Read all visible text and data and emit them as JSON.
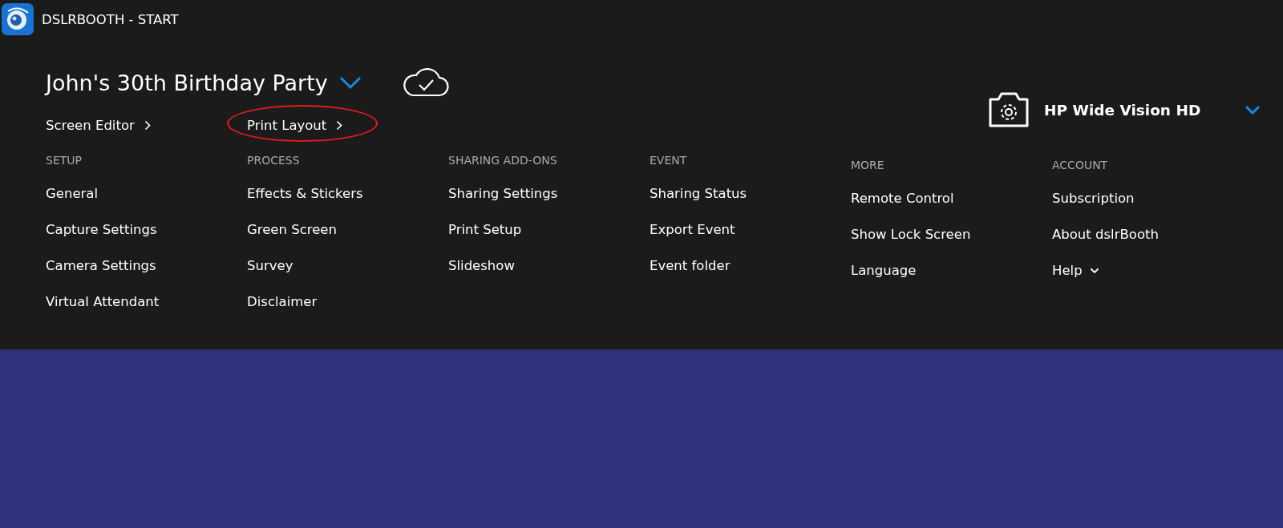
{
  "window": {
    "title": "DSLRBOOTH - START"
  },
  "event": {
    "name": "John's 30th Birthday Party",
    "synced": true
  },
  "camera": {
    "name": "HP Wide Vision HD"
  },
  "links": [
    {
      "label": "Screen Editor",
      "highlighted": false
    },
    {
      "label": "Print Layout",
      "highlighted": true
    }
  ],
  "sections": [
    {
      "title": "SETUP",
      "items": [
        {
          "label": "General",
          "kind": "link"
        },
        {
          "label": "Capture Settings",
          "kind": "link"
        },
        {
          "label": "Camera Settings",
          "kind": "link"
        },
        {
          "label": "Virtual Attendant",
          "kind": "link"
        }
      ]
    },
    {
      "title": "PROCESS",
      "items": [
        {
          "label": "Effects & Stickers",
          "kind": "link"
        },
        {
          "label": "Green Screen",
          "kind": "link"
        },
        {
          "label": "Survey",
          "kind": "link"
        },
        {
          "label": "Disclaimer",
          "kind": "link"
        }
      ]
    },
    {
      "title": "SHARING ADD-ONS",
      "items": [
        {
          "label": "Sharing Settings",
          "kind": "link"
        },
        {
          "label": "Print Setup",
          "kind": "link"
        },
        {
          "label": "Slideshow",
          "kind": "link"
        }
      ]
    },
    {
      "title": "EVENT",
      "items": [
        {
          "label": "Sharing Status",
          "kind": "link"
        },
        {
          "label": "Export Event",
          "kind": "link"
        },
        {
          "label": "Event folder",
          "kind": "link"
        }
      ]
    },
    {
      "title": "MORE",
      "items": [
        {
          "label": "Remote Control",
          "kind": "link"
        },
        {
          "label": "Show Lock Screen",
          "kind": "link"
        },
        {
          "label": "Language",
          "kind": "link"
        }
      ]
    },
    {
      "title": "ACCOUNT",
      "items": [
        {
          "label": "Subscription",
          "kind": "link"
        },
        {
          "label": "About dslrBooth",
          "kind": "link"
        },
        {
          "label": "Help",
          "kind": "dropdown"
        }
      ]
    }
  ]
}
